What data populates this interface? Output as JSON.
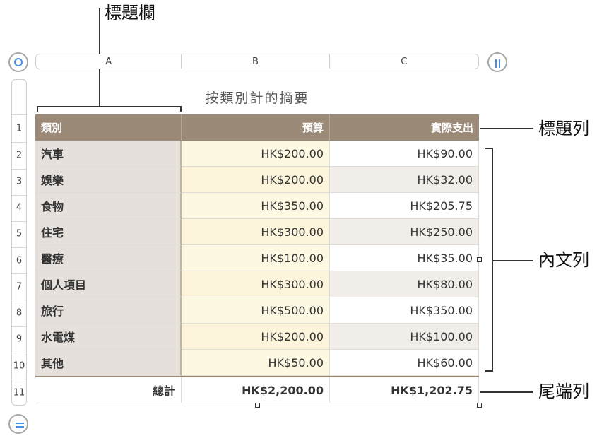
{
  "callouts": {
    "header_column": "標題欄",
    "header_row": "標題列",
    "body_rows": "內文列",
    "footer_row": "尾端列"
  },
  "columns": [
    "A",
    "B",
    "C"
  ],
  "row_numbers": [
    "1",
    "2",
    "3",
    "4",
    "5",
    "6",
    "7",
    "8",
    "9",
    "10",
    "11"
  ],
  "table": {
    "title": "按類別計的摘要",
    "header": [
      "類別",
      "預算",
      "實際支出"
    ],
    "rows": [
      [
        "汽車",
        "HK$200.00",
        "HK$90.00"
      ],
      [
        "娛樂",
        "HK$200.00",
        "HK$32.00"
      ],
      [
        "食物",
        "HK$350.00",
        "HK$205.75"
      ],
      [
        "住宅",
        "HK$300.00",
        "HK$250.00"
      ],
      [
        "醫療",
        "HK$100.00",
        "HK$35.00"
      ],
      [
        "個人項目",
        "HK$300.00",
        "HK$80.00"
      ],
      [
        "旅行",
        "HK$500.00",
        "HK$350.00"
      ],
      [
        "水電煤",
        "HK$200.00",
        "HK$100.00"
      ],
      [
        "其他",
        "HK$50.00",
        "HK$60.00"
      ]
    ],
    "footer": [
      "總計",
      "HK$2,200.00",
      "HK$1,202.75"
    ]
  },
  "colors": {
    "header_bg": "#9c8a78",
    "header_column_bg": "#e6e0dc",
    "budget_column_bg": "#fdf8e1",
    "accent": "#4a90e2"
  },
  "icons": [
    "select-table-icon",
    "column-handle-icon",
    "row-handle-icon"
  ]
}
